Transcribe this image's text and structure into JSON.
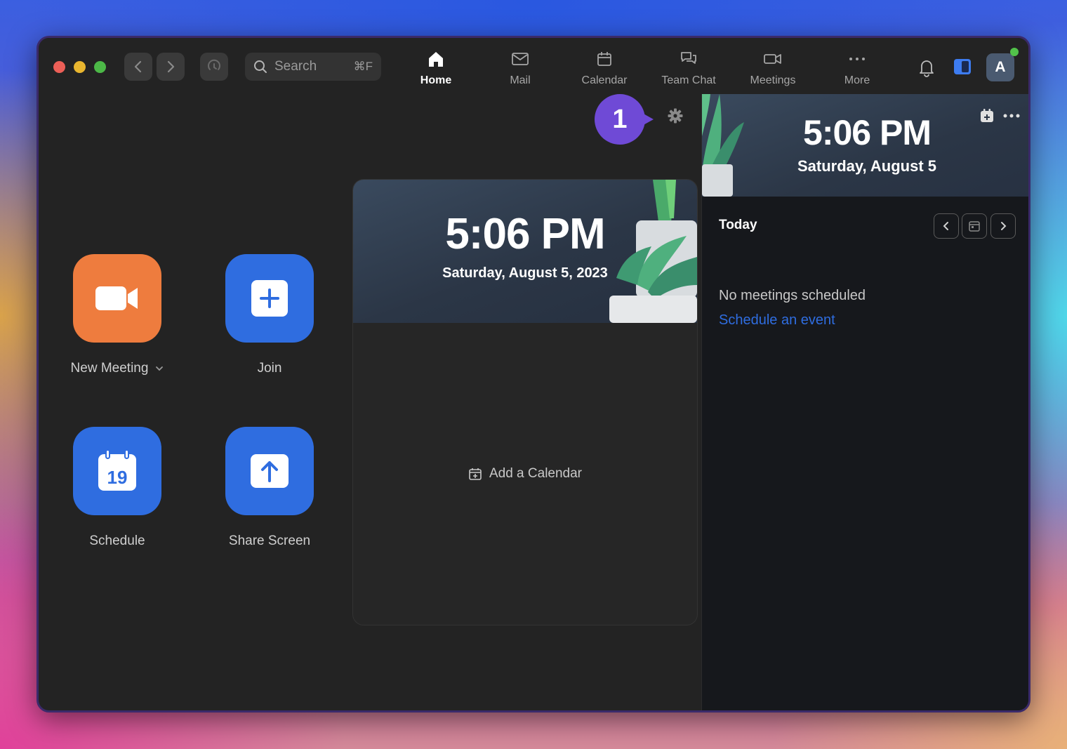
{
  "search": {
    "label": "Search",
    "shortcut": "⌘F"
  },
  "tabs": [
    {
      "label": "Home",
      "icon": "home-icon",
      "active": true
    },
    {
      "label": "Mail",
      "icon": "mail-icon"
    },
    {
      "label": "Calendar",
      "icon": "calendar-icon"
    },
    {
      "label": "Team Chat",
      "icon": "chat-icon"
    },
    {
      "label": "Meetings",
      "icon": "video-icon"
    },
    {
      "label": "More",
      "icon": "ellipsis-icon"
    }
  ],
  "user": {
    "initial": "A",
    "status_color": "#52c24a"
  },
  "actions": {
    "new_meeting": {
      "label": "New Meeting",
      "color": "#ee7c3e",
      "icon": "video-camera-icon"
    },
    "join": {
      "label": "Join",
      "color": "#2f6de0",
      "icon": "plus-icon"
    },
    "schedule": {
      "label": "Schedule",
      "color": "#2f6de0",
      "icon": "calendar-date-icon",
      "day": "19"
    },
    "share_screen": {
      "label": "Share Screen",
      "color": "#2f6de0",
      "icon": "upload-arrow-icon"
    }
  },
  "badge": {
    "number": "1",
    "color": "#6f4ad6"
  },
  "clock_card": {
    "time": "5:06 PM",
    "date": "Saturday, August 5, 2023",
    "add_calendar_label": "Add a Calendar"
  },
  "right_panel": {
    "time": "5:06 PM",
    "date": "Saturday, August 5",
    "today_label": "Today",
    "empty_text": "No meetings scheduled",
    "schedule_link": "Schedule an event",
    "link_color": "#2f6de0"
  }
}
